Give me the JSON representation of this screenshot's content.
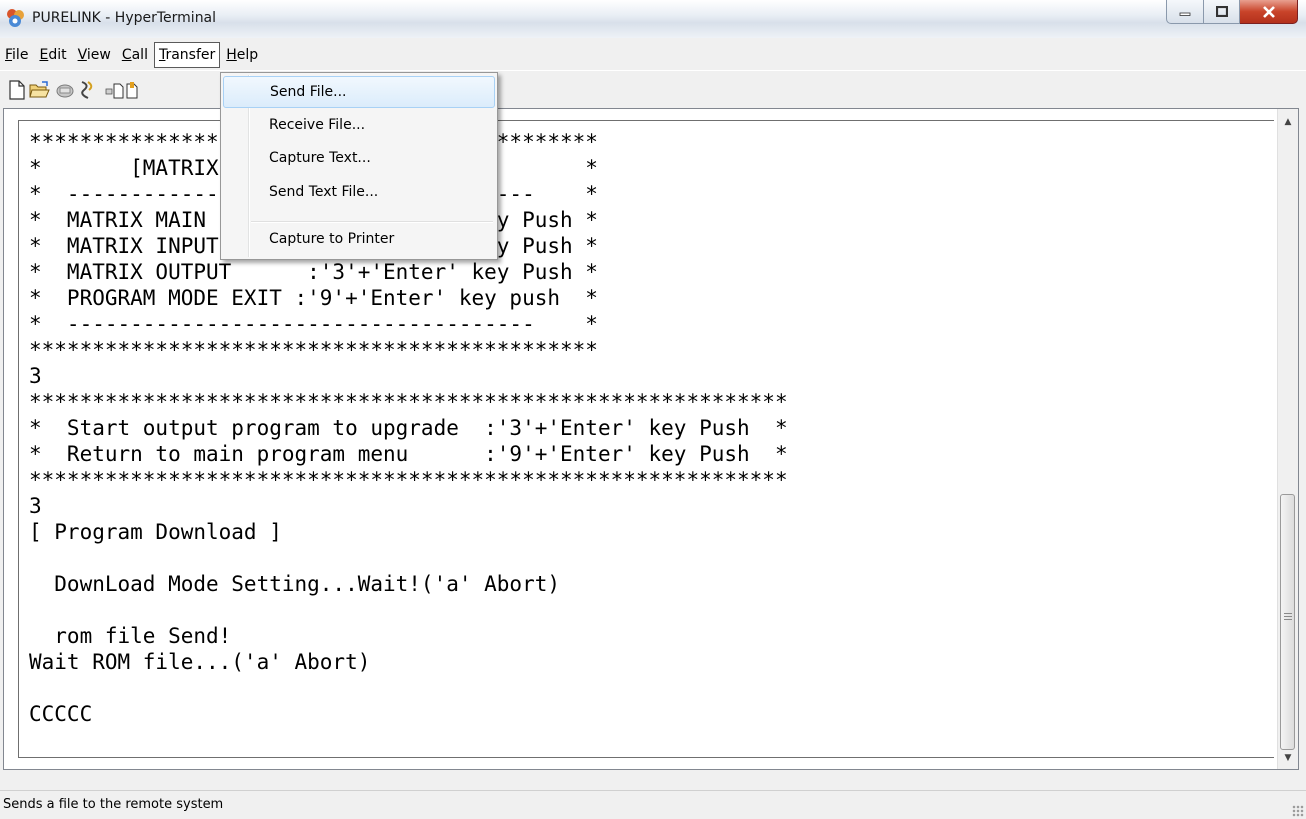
{
  "window": {
    "title": "PURELINK - HyperTerminal",
    "app_icon": "hyperterminal-icon",
    "close_color": "#c9442a"
  },
  "menubar": {
    "items": [
      {
        "label": "File",
        "accel": "F"
      },
      {
        "label": "Edit",
        "accel": "E"
      },
      {
        "label": "View",
        "accel": "V"
      },
      {
        "label": "Call",
        "accel": "C"
      },
      {
        "label": "Transfer",
        "accel": "T"
      },
      {
        "label": "Help",
        "accel": "H"
      }
    ]
  },
  "toolbar": {
    "icons": [
      "new-connection-icon",
      "open-icon",
      "call-icon",
      "disconnect-icon",
      "send-file-icon",
      "receive-file-icon"
    ]
  },
  "transfer_menu": {
    "items": [
      {
        "label": "Send File...",
        "highlighted": true
      },
      {
        "label": "Receive File..."
      },
      {
        "label": "Capture Text..."
      },
      {
        "label": "Send Text File..."
      },
      {
        "label": "Capture to Printer"
      }
    ]
  },
  "terminal": {
    "lines": [
      "*********************************************",
      "*       [MATRIX PROGRAM MODE]               *",
      "*  -------------------------------------    *",
      "*  MATRIX MAIN        :'1'+'Enter' key Push *",
      "*  MATRIX INPUT       :'2'+'Enter' key Push *",
      "*  MATRIX OUTPUT      :'3'+'Enter' key Push *",
      "*  PROGRAM MODE EXIT :'9'+'Enter' key push  *",
      "*  -------------------------------------    *",
      "*********************************************",
      "3",
      "************************************************************",
      "*  Start output program to upgrade  :'3'+'Enter' key Push  *",
      "*  Return to main program menu      :'9'+'Enter' key Push  *",
      "************************************************************",
      "3",
      "[ Program Download ]",
      "",
      "  DownLoad Mode Setting...Wait!('a' Abort)",
      "",
      "  rom file Send!",
      "Wait ROM file...('a' Abort)",
      "",
      "CCCCC"
    ]
  },
  "statusbar": {
    "text": "Sends a file to the remote system"
  }
}
